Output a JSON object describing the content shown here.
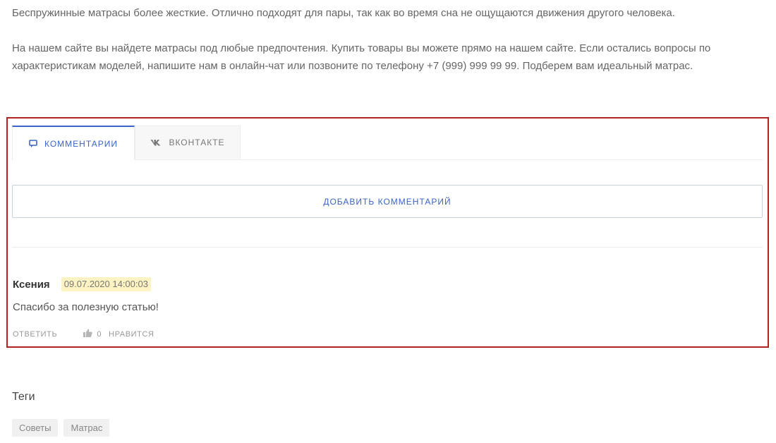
{
  "article": {
    "paragraphs": [
      "Беспружинные матрасы более жесткие. Отлично подходят для пары, так как во время сна не ощущаются движения другого человека.",
      "На нашем сайте вы найдете матрасы под любые предпочтения. Купить товары вы можете прямо на нашем сайте. Если остались вопросы по характеристикам моделей, напишите нам в онлайн-чат или позвоните по телефону +7 (999) 999 99 99. Подберем вам идеальный матрас."
    ]
  },
  "comments": {
    "tabs": [
      {
        "label": "Комментарии",
        "icon": "comment-icon",
        "active": true
      },
      {
        "label": "ВКонтакте",
        "icon": "vk-icon",
        "active": false
      }
    ],
    "add_button_label": "Добавить комментарий",
    "items": [
      {
        "author": "Ксения",
        "date": "09.07.2020 14:00:03",
        "text": "Спасибо за полезную статью!",
        "reply_label": "Ответить",
        "likes": "0",
        "like_label": "Нравится"
      }
    ]
  },
  "tags": {
    "title": "Теги",
    "items": [
      "Советы",
      "Матрас"
    ]
  },
  "colors": {
    "accent": "#3b63c9",
    "frame": "#b22222",
    "date_highlight": "#fff3c4"
  }
}
